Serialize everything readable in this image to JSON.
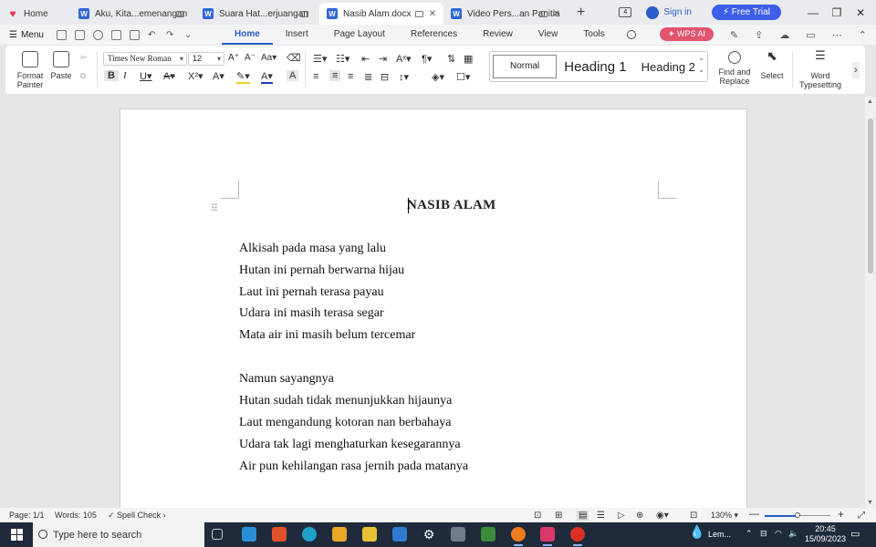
{
  "tabs": [
    {
      "label": "Home",
      "icon": "wps-home-icon"
    },
    {
      "label": "Aku, Kita...emenangan",
      "icon": "word-doc-icon"
    },
    {
      "label": "Suara Hat...erjuangan",
      "icon": "word-doc-icon"
    },
    {
      "label": "Nasib Alam.docx",
      "icon": "word-doc-icon",
      "active": true
    },
    {
      "label": "Video Pers...an Panitia",
      "icon": "word-doc-icon"
    }
  ],
  "titlebar": {
    "sign_in": "Sign in",
    "free_trial": "Free Trial"
  },
  "menu": {
    "menu_label": "Menu",
    "ribbon_tabs": [
      "Home",
      "Insert",
      "Page Layout",
      "References",
      "Review",
      "View",
      "Tools"
    ],
    "active_tab": "Home",
    "wps_ai": "WPS AI"
  },
  "ribbon": {
    "format_painter": "Format Painter",
    "paste": "Paste",
    "font_name": "Times New Roman",
    "font_size": "12",
    "styles": [
      "Normal",
      "Heading 1",
      "Heading 2"
    ],
    "find_replace": "Find and Replace",
    "select": "Select",
    "word_typesetting": "Word Typesetting"
  },
  "document": {
    "title": "NASIB ALAM",
    "lines": [
      "Alkisah pada masa yang lalu",
      "Hutan ini pernah berwarna hijau",
      "Laut ini pernah terasa payau",
      "Udara ini masih terasa segar",
      "Mata air ini masih belum tercemar",
      "",
      "Namun sayangnya",
      "Hutan sudah tidak menunjukkan hijaunya",
      "Laut mengandung kotoran nan berbahaya",
      "Udara tak lagi menghaturkan kesegarannya",
      "Air pun kehilangan rasa jernih pada matanya"
    ]
  },
  "status": {
    "page": "Page: 1/1",
    "words": "Words: 105",
    "spell_check": "Spell Check",
    "zoom": "130%",
    "zoom_fraction": 0.5
  },
  "taskbar": {
    "search_placeholder": "Type here to search",
    "weather": "Lem...",
    "time": "20:45",
    "date": "15/09/2023"
  },
  "colors": {
    "accent": "#2b5bc8",
    "wps_ai": "#e1546e",
    "free_trial": "#3d5ee8",
    "taskbar": "#1f2a3a"
  }
}
